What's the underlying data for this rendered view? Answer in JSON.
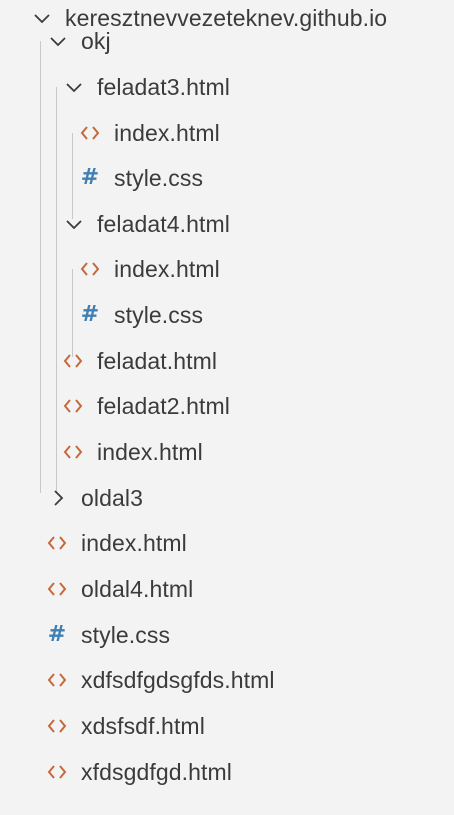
{
  "explorer": {
    "root": {
      "label": "keresztnevvezeteknev.github.io",
      "expanded": true
    },
    "items": [
      {
        "label": "okj",
        "type": "folder",
        "expanded": true,
        "depth": 1
      },
      {
        "label": "feladat3.html",
        "type": "folder",
        "expanded": true,
        "depth": 2
      },
      {
        "label": "index.html",
        "type": "html",
        "depth": 3
      },
      {
        "label": "style.css",
        "type": "css",
        "depth": 3
      },
      {
        "label": "feladat4.html",
        "type": "folder",
        "expanded": true,
        "depth": 2
      },
      {
        "label": "index.html",
        "type": "html",
        "depth": 3
      },
      {
        "label": "style.css",
        "type": "css",
        "depth": 3
      },
      {
        "label": "feladat.html",
        "type": "html",
        "depth": 2
      },
      {
        "label": "feladat2.html",
        "type": "html",
        "depth": 2
      },
      {
        "label": "index.html",
        "type": "html",
        "depth": 2
      },
      {
        "label": "oldal3",
        "type": "folder",
        "expanded": false,
        "depth": 1
      },
      {
        "label": "index.html",
        "type": "html",
        "depth": 1
      },
      {
        "label": "oldal4.html",
        "type": "html",
        "depth": 1
      },
      {
        "label": "style.css",
        "type": "css",
        "depth": 1
      },
      {
        "label": "xdfsdfgdsgfds.html",
        "type": "html",
        "depth": 1
      },
      {
        "label": "xdsfsdf.html",
        "type": "html",
        "depth": 1
      },
      {
        "label": "xfdsgdfgd.html",
        "type": "html",
        "depth": 1
      }
    ]
  },
  "colors": {
    "background": "#f3f3f3",
    "text": "#3b3b3b",
    "html_icon": "#c5683c",
    "css_icon": "#3f7fb3",
    "chevron": "#3b3b3b",
    "indent_guide": "#c8c8c8"
  }
}
